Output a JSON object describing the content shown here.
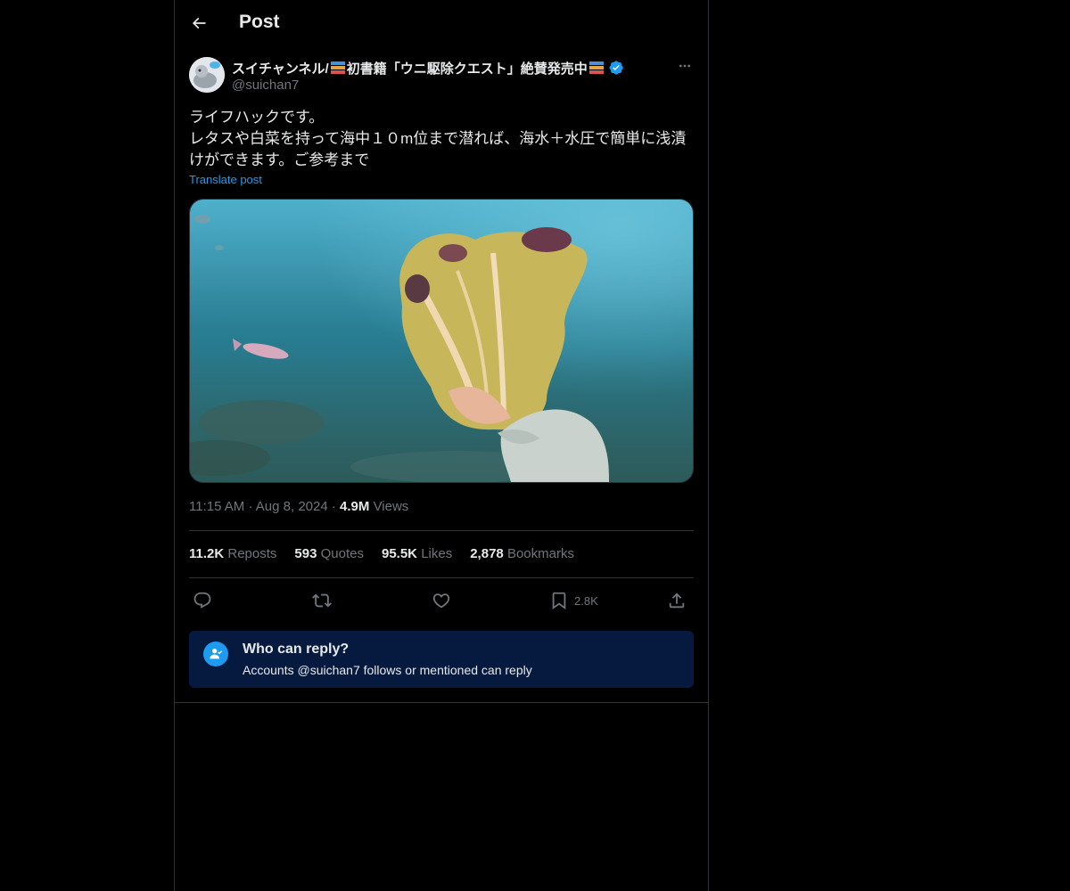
{
  "header": {
    "title": "Post"
  },
  "author": {
    "name_part1": "スイチャンネル/",
    "name_part2": "初書籍「ウニ駆除クエスト」絶賛発売中",
    "handle": "@suichan7"
  },
  "post": {
    "text": "ライフハックです。\nレタスや白菜を持って海中１０m位まで潜れば、海水＋水圧で簡単に浅漬けができます。ご参考まで",
    "translate_label": "Translate post"
  },
  "meta": {
    "time": "11:15 AM",
    "date": "Aug 8, 2024",
    "views_count": "4.9M",
    "views_label": "Views"
  },
  "stats": {
    "reposts_count": "11.2K",
    "reposts_label": "Reposts",
    "quotes_count": "593",
    "quotes_label": "Quotes",
    "likes_count": "95.5K",
    "likes_label": "Likes",
    "bookmarks_count": "2,878",
    "bookmarks_label": "Bookmarks"
  },
  "actions": {
    "bookmark_count": "2.8K"
  },
  "reply_restriction": {
    "title": "Who can reply?",
    "subtitle": "Accounts @suichan7 follows or mentioned can reply"
  },
  "colors": {
    "background": "#000000",
    "accent": "#1d9bf0",
    "secondary_text": "#71767b",
    "primary_text": "#e7e9ea",
    "reply_box": "#061a40"
  }
}
